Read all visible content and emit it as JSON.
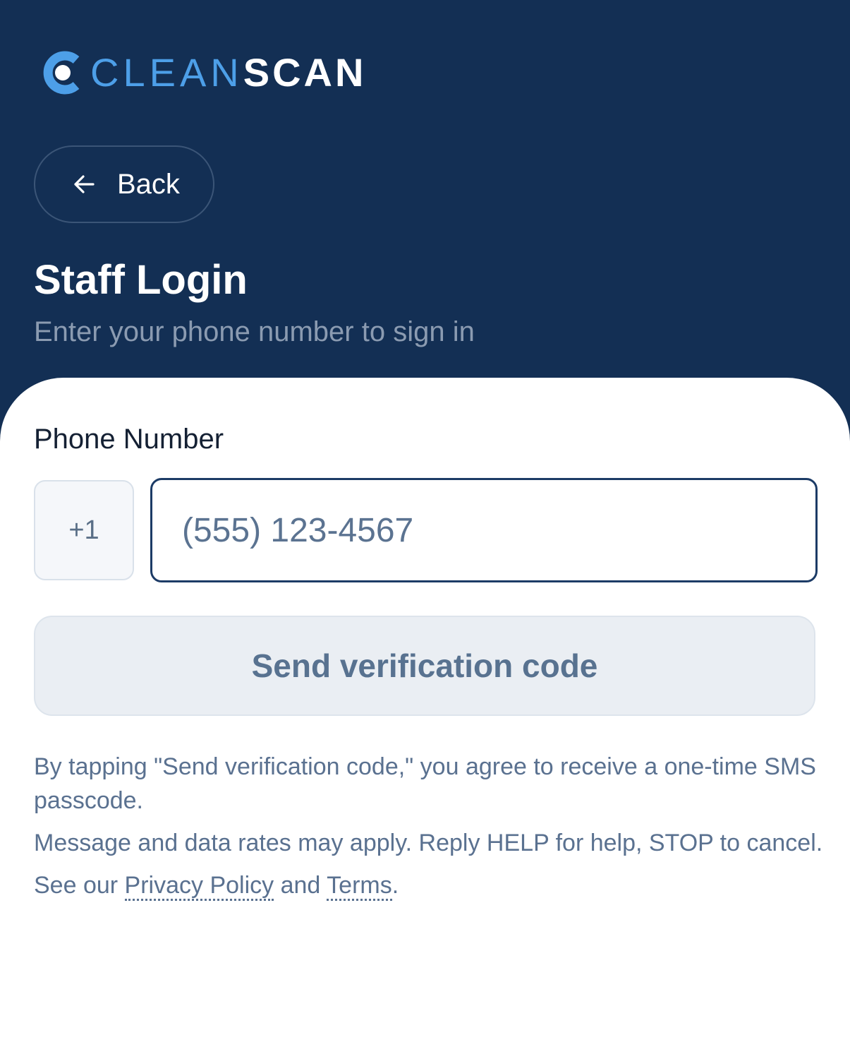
{
  "colors": {
    "header_bg": "#132f54",
    "brand_accent": "#4d9fe8",
    "input_border": "#1c3b66",
    "button_bg": "#eaeef3",
    "muted_text": "#5a7190"
  },
  "logo": {
    "icon": "cleanscan-c-logo-icon",
    "text_part1": "CLEAN",
    "text_part2": "SCAN"
  },
  "header": {
    "back_icon": "arrow-left-icon",
    "back_label": "Back",
    "title": "Staff Login",
    "subtitle": "Enter your phone number to sign in"
  },
  "form": {
    "phone_label": "Phone Number",
    "country_code": "+1",
    "phone_placeholder": "(555) 123-4567",
    "phone_value": "",
    "submit_label": "Send verification code"
  },
  "legal": {
    "consent": "By tapping \"Send verification code,\" you agree to receive a one-time SMS passcode.",
    "rates": "Message and data rates may apply. Reply HELP for help, STOP to cancel.",
    "see_our": "See our ",
    "privacy_link": "Privacy Policy",
    "and": " and ",
    "terms_link": "Terms",
    "period": "."
  }
}
